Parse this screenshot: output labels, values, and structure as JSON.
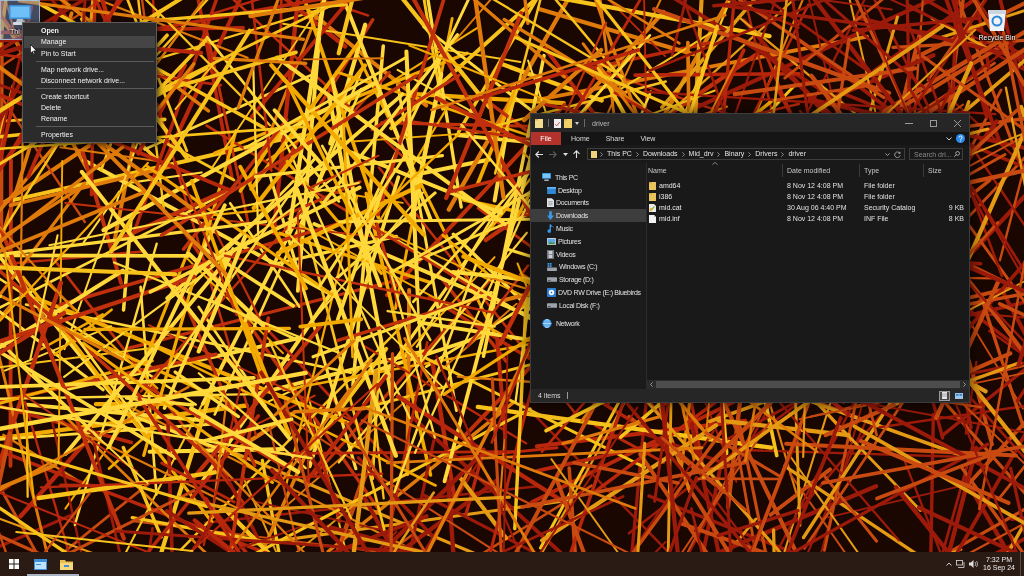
{
  "desktop_icons": [
    {
      "kind": "computer",
      "label": "Thi",
      "selected": true
    },
    {
      "kind": "bin",
      "label": "Recycle Bin",
      "selected": false
    }
  ],
  "context_menu": {
    "groups": [
      [
        {
          "label": "Open",
          "default": true,
          "selected": false
        },
        {
          "label": "Manage",
          "default": false,
          "selected": true
        },
        {
          "label": "Pin to Start",
          "default": false,
          "selected": false
        }
      ],
      [
        {
          "label": "Map network drive...",
          "default": false,
          "selected": false
        },
        {
          "label": "Disconnect network drive...",
          "default": false,
          "selected": false
        }
      ],
      [
        {
          "label": "Create shortcut",
          "default": false,
          "selected": false
        },
        {
          "label": "Delete",
          "default": false,
          "selected": false
        },
        {
          "label": "Rename",
          "default": false,
          "selected": false
        }
      ],
      [
        {
          "label": "Properties",
          "default": false,
          "selected": false
        }
      ]
    ]
  },
  "explorer": {
    "title": "driver",
    "ribbon": [
      {
        "kind": "menu",
        "label": "File"
      },
      {
        "kind": "tab",
        "label": "Home"
      },
      {
        "kind": "tab",
        "label": "Share"
      },
      {
        "kind": "tab",
        "label": "View"
      }
    ],
    "navigation": [
      {
        "kind": "back",
        "disabled": false
      },
      {
        "kind": "forward",
        "disabled": true
      },
      {
        "kind": "recent",
        "disabled": false
      },
      {
        "kind": "up",
        "disabled": false
      }
    ],
    "address": [
      "This PC",
      "Downloads",
      "Mid_drv",
      "Binary",
      "Drivers",
      "driver"
    ],
    "search": {
      "placeholder": "Search dri..."
    },
    "sidebar": [
      {
        "kind": "computer",
        "label": "This PC",
        "selected": false,
        "children": [
          {
            "kind": "desktop",
            "label": "Desktop",
            "selected": false
          },
          {
            "kind": "documents",
            "label": "Documents",
            "selected": false
          },
          {
            "kind": "downloads",
            "label": "Downloads",
            "selected": true
          },
          {
            "kind": "music",
            "label": "Music",
            "selected": false
          },
          {
            "kind": "pictures",
            "label": "Pictures",
            "selected": false
          },
          {
            "kind": "videos",
            "label": "Videos",
            "selected": false
          },
          {
            "kind": "windows",
            "label": "Windows (C:)",
            "selected": false
          },
          {
            "kind": "drive",
            "label": "Storage (D:)",
            "selected": false
          },
          {
            "kind": "disc",
            "label": "DVD RW Drive (E:) Bluebirds",
            "selected": false
          },
          {
            "kind": "drive",
            "label": "Local Disk (F:)",
            "selected": false
          }
        ]
      },
      {
        "kind": "network",
        "label": "Network",
        "selected": false
      }
    ],
    "columns": [
      {
        "label": "Name",
        "sorted": true
      },
      {
        "label": "Date modified",
        "sorted": false
      },
      {
        "label": "Type",
        "sorted": false
      },
      {
        "label": "Size",
        "sorted": false
      }
    ],
    "files": [
      {
        "kind": "folder",
        "name": "amd64",
        "date_modified": "8 Nov 12 4:08 PM",
        "type": "File folder"
      },
      {
        "kind": "folder",
        "name": "i386",
        "date_modified": "8 Nov 12 4:08 PM",
        "type": "File folder"
      },
      {
        "kind": "catalog",
        "name": "mid.cat",
        "date_modified": "30 Aug 06 4:40 PM",
        "type": "Security Catalog",
        "size": "9 KB"
      },
      {
        "kind": "file",
        "name": "mid.inf",
        "date_modified": "8 Nov 12 4:08 PM",
        "type": "INF File",
        "size": "8 KB"
      }
    ],
    "status": {
      "item_count": "4 items"
    },
    "views": [
      {
        "kind": "details",
        "selected": true
      },
      {
        "kind": "tiles",
        "selected": false
      }
    ]
  },
  "taskbar": {
    "apps": [
      {
        "kind": "window",
        "running": true
      },
      {
        "kind": "folder",
        "running": true
      }
    ],
    "clock": {
      "time": "7:32 PM",
      "date": "16 Sep 24"
    }
  }
}
